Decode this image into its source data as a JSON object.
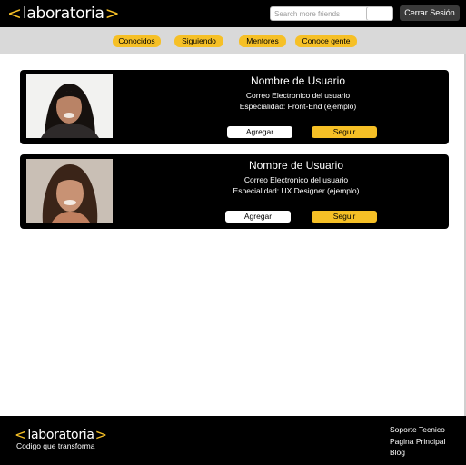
{
  "header": {
    "logo": {
      "left_bracket": "<",
      "word": "laboratoria",
      "right_bracket": ">"
    },
    "search": {
      "placeholder": "Search more friends",
      "value": ""
    },
    "logout_label": "Cerrar Sesión"
  },
  "nav": {
    "items": [
      {
        "label": "Conocidos"
      },
      {
        "label": "Siguiendo"
      },
      {
        "label": "Mentores"
      },
      {
        "label": "Conoce gente"
      }
    ]
  },
  "users": [
    {
      "name": "Nombre de Usuario",
      "email": "Correo Electronico del usuario",
      "specialty": "Especialidad: Front-End (ejemplo)",
      "add_label": "Agregar",
      "follow_label": "Seguir"
    },
    {
      "name": "Nombre de Usuario",
      "email": "Correo Electronico del usuario",
      "specialty": "Especialidad: UX Designer (ejemplo)",
      "add_label": "Agregar",
      "follow_label": "Seguir"
    }
  ],
  "footer": {
    "logo": {
      "left_bracket": "<",
      "word": "laboratoria",
      "right_bracket": ">"
    },
    "tagline": "Codigo que transforma",
    "links": [
      {
        "label": "Soporte Tecnico"
      },
      {
        "label": "Pagina Principal"
      },
      {
        "label": "Blog"
      }
    ]
  },
  "colors": {
    "accent": "#f6c026",
    "header_bg": "#000000",
    "nav_bg": "#d9d9d9",
    "card_bg": "#000000"
  }
}
